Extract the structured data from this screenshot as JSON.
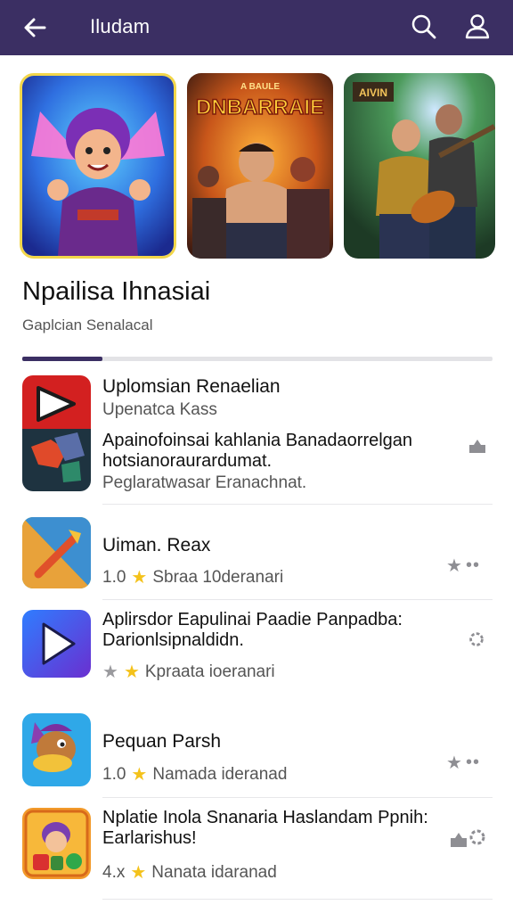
{
  "header": {
    "title": "Iludam",
    "back_icon": "arrow-left-icon",
    "search_icon": "search-icon",
    "account_icon": "account-icon"
  },
  "banners": [
    {
      "name": "banner-fairy-warrior"
    },
    {
      "name": "banner-dnbarraie",
      "logo_text": "DNBARRAIE",
      "logo_top": "A BAULE"
    },
    {
      "name": "banner-guitar-heroes",
      "logo_text": "AIVIN"
    }
  ],
  "section": {
    "title": "Npailisa Ihnasiai",
    "subtitle": "Gaplcian Senalacal",
    "progress": 0.17
  },
  "apps": [
    {
      "name": "Uplomsian Renaelian",
      "developer": "Upenatca Kass",
      "description": "Apainofoinsai kahlania Banadaorrelgan\nhotsianoraurardumat.",
      "note": "Peglaratwasar Eranachnat."
    },
    {
      "name": "Uiman. Reax",
      "rating": "1.0",
      "meta": "Sbraa 10deranari"
    },
    {
      "name": "Aplirsdor Eapulinai Paadie Panpadba:\nDarionlsipnaldidn.",
      "meta": "Kpraata ioeranari"
    },
    {
      "name": "Pequan Parsh",
      "rating": "1.0",
      "meta": "Namada ideranad"
    },
    {
      "name": "Nplatie Inola Snanaria Haslandam Ppnih:\nEarlarishus!",
      "rating": "4.x",
      "meta": "Nanata idaranad"
    }
  ],
  "colors": {
    "header_bg": "#3b2f63",
    "star_yellow": "#f4c21b",
    "muted_icon": "#8e8e93"
  }
}
